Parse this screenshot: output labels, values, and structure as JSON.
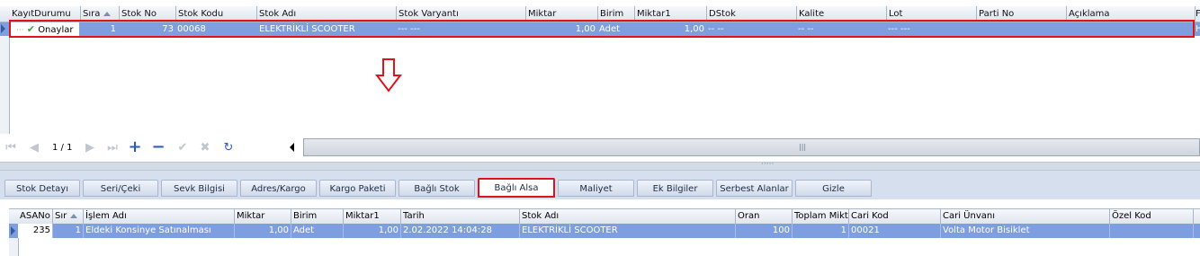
{
  "top_grid": {
    "columns": [
      "KayıtDurumu",
      "Sıra",
      "Stok No",
      "Stok Kodu",
      "Stok Adı",
      "Stok Varyantı",
      "Miktar",
      "Birim",
      "Miktar1",
      "DStok",
      "Kalite",
      "Lot",
      "Parti No",
      "Açıklama",
      "F"
    ],
    "row": {
      "status": "Onaylar",
      "sira": "1",
      "stok_no": "73",
      "stok_kodu": "00068",
      "stok_adi": "ELEKTRİKLİ SCOOTER",
      "stok_varyanti": "--- ---",
      "miktar": "1,00",
      "birim": "Adet",
      "miktar1": "1,00",
      "dstok": "-- --",
      "kalite": "-- --",
      "lot": "--- ---",
      "parti_no": "",
      "aciklama": "",
      "extra": "H"
    }
  },
  "navigator": {
    "page_label": "1 / 1"
  },
  "tabs": [
    "Stok Detayı",
    "Seri/Çeki",
    "Sevk Bilgisi",
    "Adres/Kargo",
    "Kargo Paketi",
    "Bağlı Stok",
    "Bağlı Alsa",
    "Maliyet",
    "Ek Bilgiler",
    "Serbest Alanlar",
    "Gizle"
  ],
  "bottom_grid": {
    "columns": [
      "ASANo",
      "Sır",
      "İşlem Adı",
      "Miktar",
      "Birim",
      "Miktar1",
      "Tarih",
      "Stok Adı",
      "Oran",
      "Toplam Miktar",
      "Cari Kod",
      "Cari Ünvanı",
      "Özel Kod"
    ],
    "row": [
      "235",
      "1",
      "Eldeki Konsinye Satınalması",
      "1,00",
      "Adet",
      "1,00",
      "2.02.2022 14:04:28",
      "ELEKTRİKLİ SCOOTER",
      "100",
      "1",
      "00021",
      "Volta Motor Bisiklet",
      ""
    ]
  },
  "colors": {
    "selection": "#7f9ee0",
    "highlight": "#e0121b"
  }
}
